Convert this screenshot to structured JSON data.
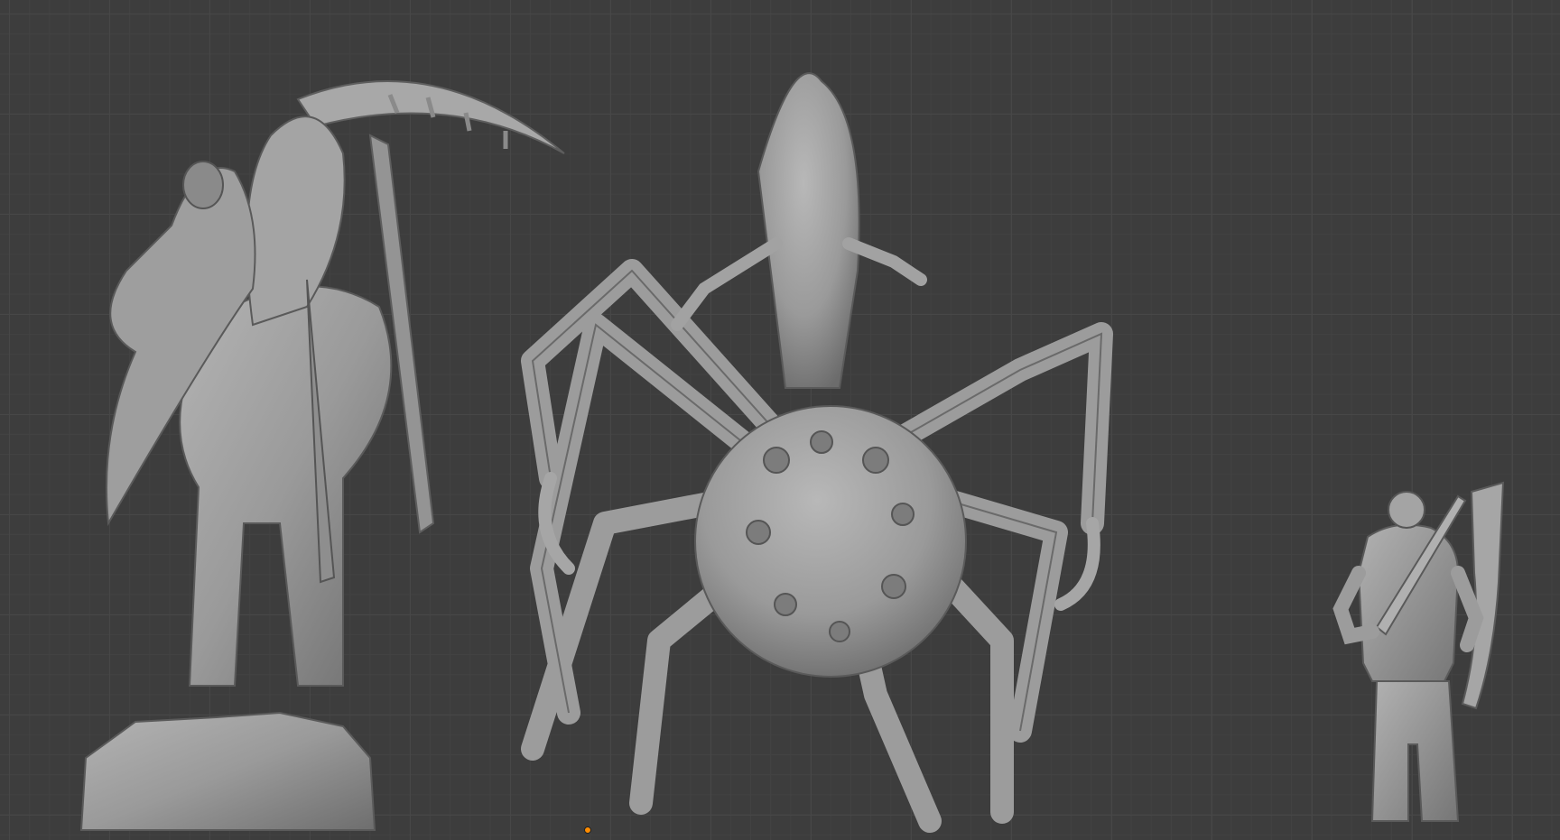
{
  "viewport": {
    "background_color": "#3d3d3d",
    "grid_major_color": "#474747",
    "grid_minor_color": "#424242",
    "mesh_color": "#9a9a9a",
    "origin_color": "#ff8c00"
  },
  "scene": {
    "objects": [
      {
        "name": "reaper-on-mount-sculpt",
        "icon": "sculpt-mesh"
      },
      {
        "name": "giant-spider-sculpt",
        "icon": "sculpt-mesh"
      },
      {
        "name": "armored-soldier-sculpt",
        "icon": "sculpt-mesh"
      }
    ]
  }
}
